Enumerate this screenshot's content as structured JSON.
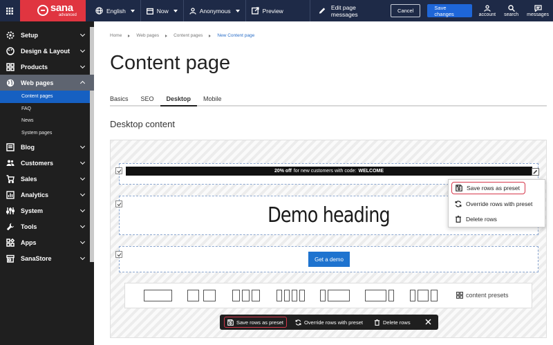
{
  "topbar": {
    "logo_name": "sana",
    "logo_sub": "advanced",
    "language": "English",
    "date": "Now",
    "user": "Anonymous",
    "preview": "Preview",
    "edit_messages": "Edit page messages",
    "cancel": "Cancel",
    "save": "Save changes",
    "account": "account",
    "search": "search",
    "messages": "messages"
  },
  "sidebar": {
    "items": [
      {
        "label": "Setup",
        "icon": "gear-icon"
      },
      {
        "label": "Design & Layout",
        "icon": "palette-icon"
      },
      {
        "label": "Products",
        "icon": "products-icon"
      },
      {
        "label": "Web pages",
        "icon": "globe-icon"
      },
      {
        "label": "Blog",
        "icon": "blog-icon"
      },
      {
        "label": "Customers",
        "icon": "customers-icon"
      },
      {
        "label": "Sales",
        "icon": "cart-icon"
      },
      {
        "label": "Analytics",
        "icon": "analytics-icon"
      },
      {
        "label": "System",
        "icon": "system-icon"
      },
      {
        "label": "Tools",
        "icon": "wrench-icon"
      },
      {
        "label": "Apps",
        "icon": "apps-icon"
      },
      {
        "label": "SanaStore",
        "icon": "store-icon"
      }
    ],
    "sub_items": [
      "Content pages",
      "FAQ",
      "News",
      "System pages"
    ]
  },
  "breadcrumb": [
    "Home",
    "Web pages",
    "Content pages",
    "New Content page"
  ],
  "page_title": "Content page",
  "tabs": [
    "Basics",
    "SEO",
    "Desktop",
    "Mobile"
  ],
  "section_title": "Desktop content",
  "editor": {
    "promo_bold": "20% off",
    "promo_text": "for new customers with code:",
    "promo_code": "WELCOME",
    "heading": "Demo heading",
    "button": "Get a demo",
    "presets_label": "content presets"
  },
  "context_menu": {
    "save": "Save rows as preset",
    "override": "Override rows with preset",
    "delete": "Delete rows"
  },
  "bottom_bar": {
    "save": "Save rows as preset",
    "override": "Override rows with preset",
    "delete": "Delete rows"
  },
  "colors": {
    "topbar": "#1e2a47",
    "brand": "#e03540",
    "accent": "#1e66d8",
    "highlight": "#d6364a"
  }
}
